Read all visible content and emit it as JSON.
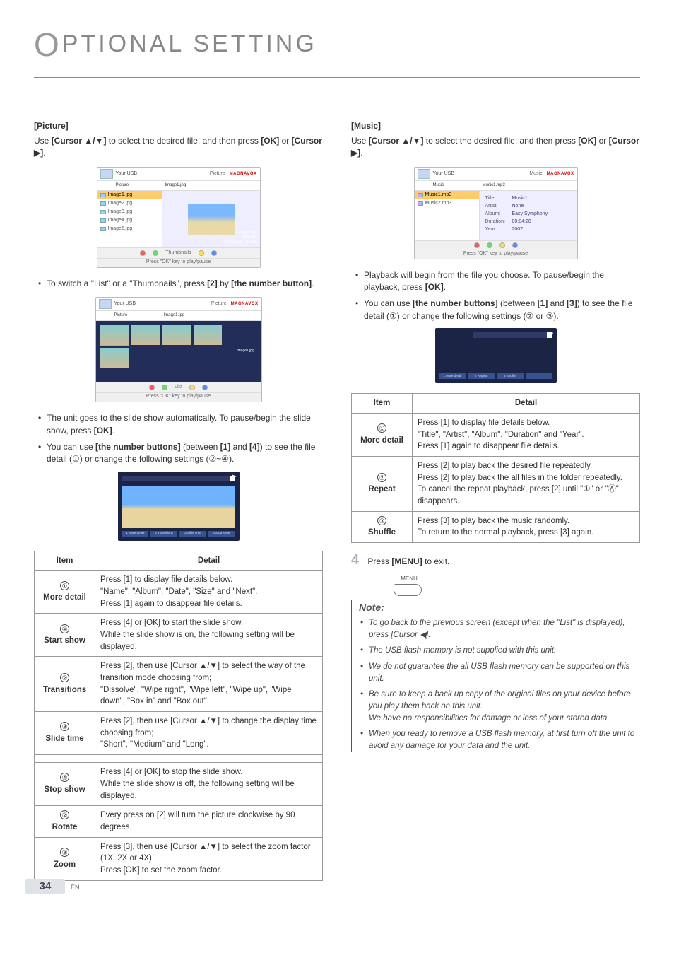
{
  "page": {
    "number": "34",
    "lang": "EN"
  },
  "title": "PTIONAL  SETTING",
  "picture": {
    "heading": "[Picture]",
    "intro_a": "Use ",
    "intro_b": "[Cursor ▲/▼]",
    "intro_c": " to select the desired file, and then press ",
    "intro_d": "[OK]",
    "intro_e": " or ",
    "intro_f": "[Cursor ▶]",
    "intro_g": ".",
    "sslist": {
      "top": "Your USB",
      "pathlabel": "Picture",
      "brand": "MAGNAVOX",
      "crumb": "Picture",
      "filehdr": "Image1.jpg",
      "files": [
        "Image1.jpg",
        "Image2.jpg",
        "Image3.jpg",
        "Image4.jpg",
        "Image5.jpg"
      ],
      "meta1": "Image1.jpg",
      "meta2": "1366 963",
      "meta3": "2009.04.03 17:43:06",
      "footerA": "Thumbnails",
      "footerB": "Press \"OK\" key to play/pause"
    },
    "switch_a": "To switch a \"List\" or a \"Thumbnails\", press ",
    "switch_b": "[2]",
    "switch_c": " by ",
    "switch_d": "[the number button]",
    "switch_e": ".",
    "ssthumb": {
      "top": "Your USB",
      "pathlabel": "Picture",
      "brand": "MAGNAVOX",
      "crumb": "Picture",
      "filehdr": "Image1.jpg",
      "side": "Image1.jpg",
      "footerA": "List",
      "footerB": "Press \"OK\" key to play/pause"
    },
    "auto_a": "The unit goes to the slide show automatically. To pause/begin the slide show, press ",
    "auto_b": "[OK]",
    "auto_c": ".",
    "nb_a": "You can use ",
    "nb_b": "[the number buttons]",
    "nb_c": " (between ",
    "nb_d": "[1]",
    "nb_e": " and ",
    "nb_f": "[4]",
    "nb_g": ") to see the file detail (①) or change the following settings (②~④).",
    "player_btns": [
      "1 More detail",
      "2 Transitions",
      "3 Slide time",
      "4 Stop show"
    ],
    "table": {
      "h1": "Item",
      "h2": "Detail",
      "rows_a": [
        {
          "n": "①",
          "name": "More detail",
          "d": "Press [1] to display file details below.\n\"Name\", \"Album\", \"Date\", \"Size\" and \"Next\".\nPress [1] again to disappear file details."
        },
        {
          "n": "④",
          "name": "Start show",
          "d": "Press [4] or [OK] to start the slide show.\nWhile the slide show is on, the following setting will be displayed."
        },
        {
          "n": "②",
          "name": "Transitions",
          "d": "Press [2], then use [Cursor ▲/▼] to select the way of the transition mode choosing from;\n\"Dissolve\", \"Wipe right\", \"Wipe left\", \"Wipe up\", \"Wipe down\", \"Box in\" and \"Box out\"."
        },
        {
          "n": "③",
          "name": "Slide time",
          "d": "Press [2], then use [Cursor ▲/▼] to change the display time choosing from;\n\"Short\", \"Medium\" and \"Long\"."
        }
      ],
      "rows_b": [
        {
          "n": "④",
          "name": "Stop show",
          "d": "Press [4] or [OK] to stop the slide show.\nWhile the slide show is off, the following setting will be displayed."
        },
        {
          "n": "②",
          "name": "Rotate",
          "d": "Every press on [2] will turn the picture clockwise by 90 degrees."
        },
        {
          "n": "③",
          "name": "Zoom",
          "d": "Press [3], then use [Cursor ▲/▼] to select the zoom factor (1X, 2X or 4X).\nPress [OK] to set the zoom factor."
        }
      ]
    }
  },
  "music": {
    "heading": "[Music]",
    "intro_a": "Use ",
    "intro_b": "[Cursor ▲/▼]",
    "intro_c": " to select the desired file, and then press ",
    "intro_d": "[OK]",
    "intro_e": " or ",
    "intro_f": "[Cursor ▶]",
    "intro_g": ".",
    "ss": {
      "top": "Your USB",
      "pathlabel": "Music",
      "brand": "MAGNAVOX",
      "crumb": "Music",
      "filehdr": "Music1.mp3",
      "files": [
        "Music1.mp3",
        "Music2.mp3"
      ],
      "kv": [
        [
          "Title:",
          "Music1"
        ],
        [
          "Artist:",
          "None"
        ],
        [
          "Album:",
          "Easy Symphony"
        ],
        [
          "Duration:",
          "00:04:28"
        ],
        [
          "Year:",
          "2007"
        ]
      ],
      "footerB": "Press \"OK\" key to play/pause"
    },
    "pb_a": "Playback will begin from the file you choose. To pause/begin the playback, press ",
    "pb_b": "[OK]",
    "pb_c": ".",
    "nb_a": "You can use ",
    "nb_b": "[the number buttons]",
    "nb_c": " (between ",
    "nb_d": "[1]",
    "nb_e": " and ",
    "nb_f": "[3]",
    "nb_g": ") to see the file detail (①) or change the following settings (② or ③).",
    "player_btns": [
      "1 More detail",
      "2 Repeat",
      "3 Shuffle",
      ""
    ],
    "table": {
      "h1": "Item",
      "h2": "Detail",
      "rows": [
        {
          "n": "①",
          "name": "More detail",
          "d": "Press [1] to display file details below.\n\"Title\", \"Artist\", \"Album\", \"Duration\" and \"Year\".\nPress [1] again to disappear file details."
        },
        {
          "n": "②",
          "name": "Repeat",
          "d": "Press [2] to play back the desired file repeatedly.\nPress [2] to play back the all files in the folder repeatedly.\nTo cancel the repeat playback, press [2] until \"①\" or \"Ⓐ\" disappears."
        },
        {
          "n": "③",
          "name": "Shuffle",
          "d": "Press [3] to play back the music randomly.\nTo return to the normal playback, press [3] again."
        }
      ]
    },
    "step4_a": "Press ",
    "step4_b": "[MENU]",
    "step4_c": " to exit.",
    "menu_label": "MENU"
  },
  "note": {
    "title": "Note:",
    "items": [
      "To go back to the previous screen (except when the \"List\" is displayed), press [Cursor ◀].",
      "The USB flash memory is not supplied with this unit.",
      "We do not guarantee the all USB flash memory can be supported on this unit.",
      "Be sure to keep a back up copy of the original files on your device before you play them back on this unit.\nWe have no responsibilities for damage or loss of your stored data.",
      "When you ready to remove a USB flash memory, at first turn off the unit to avoid any damage for your data and the unit."
    ]
  }
}
